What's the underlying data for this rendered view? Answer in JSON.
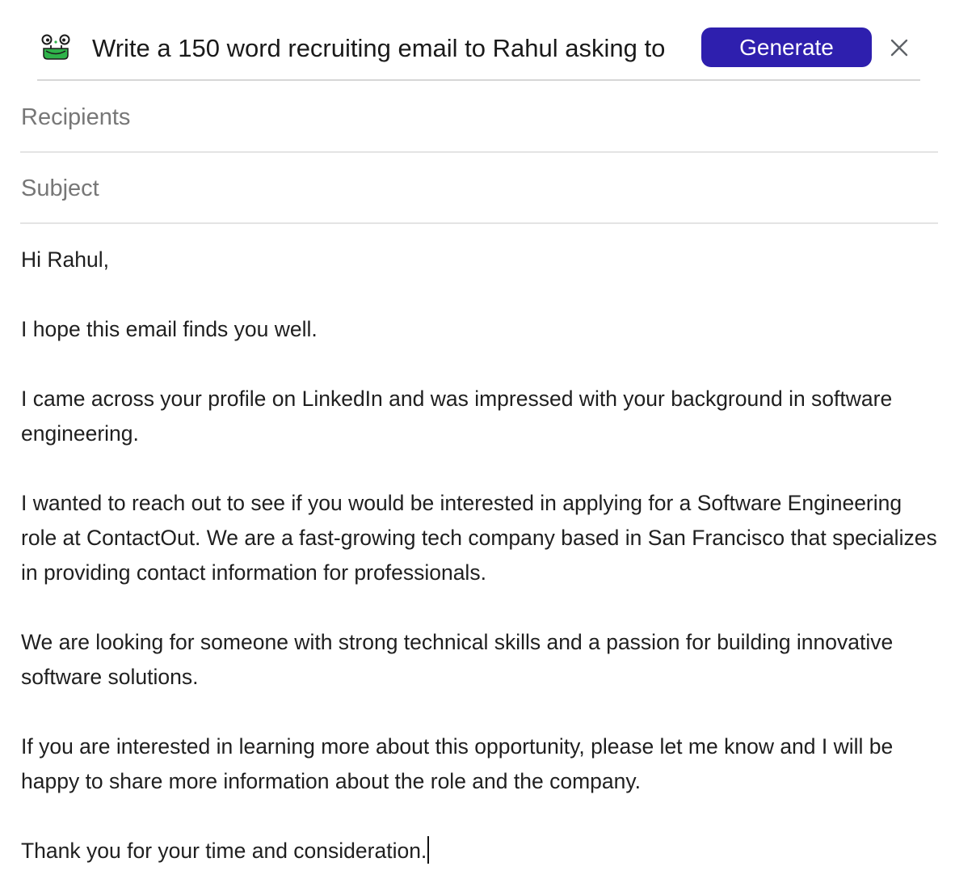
{
  "prompt": {
    "icon": "robot-frog-icon",
    "text": "Write a 150 word recruiting email to Rahul asking to",
    "generate_label": "Generate",
    "close_icon": "close-icon",
    "colors": {
      "generate_bg": "#2e1fae",
      "generate_text": "#ffffff",
      "icon_green": "#2fb34a"
    }
  },
  "fields": {
    "recipients_placeholder": "Recipients",
    "subject_placeholder": "Subject"
  },
  "body": {
    "paragraphs": [
      "Hi Rahul,",
      "I hope this email finds you well.",
      "I came across your profile on LinkedIn and was impressed with your background in software engineering.",
      "I wanted to reach out to see if you would be interested in applying for a Software Engineering role at ContactOut. We are a fast-growing tech company based in San Francisco that specializes in providing contact information for professionals.",
      "We are looking for someone with strong technical skills and a passion for building innovative software solutions.",
      "If you are interested in learning more about this opportunity, please let me know and I will be happy to share more information about the role and the company.",
      "Thank you for your time and consideration."
    ]
  }
}
